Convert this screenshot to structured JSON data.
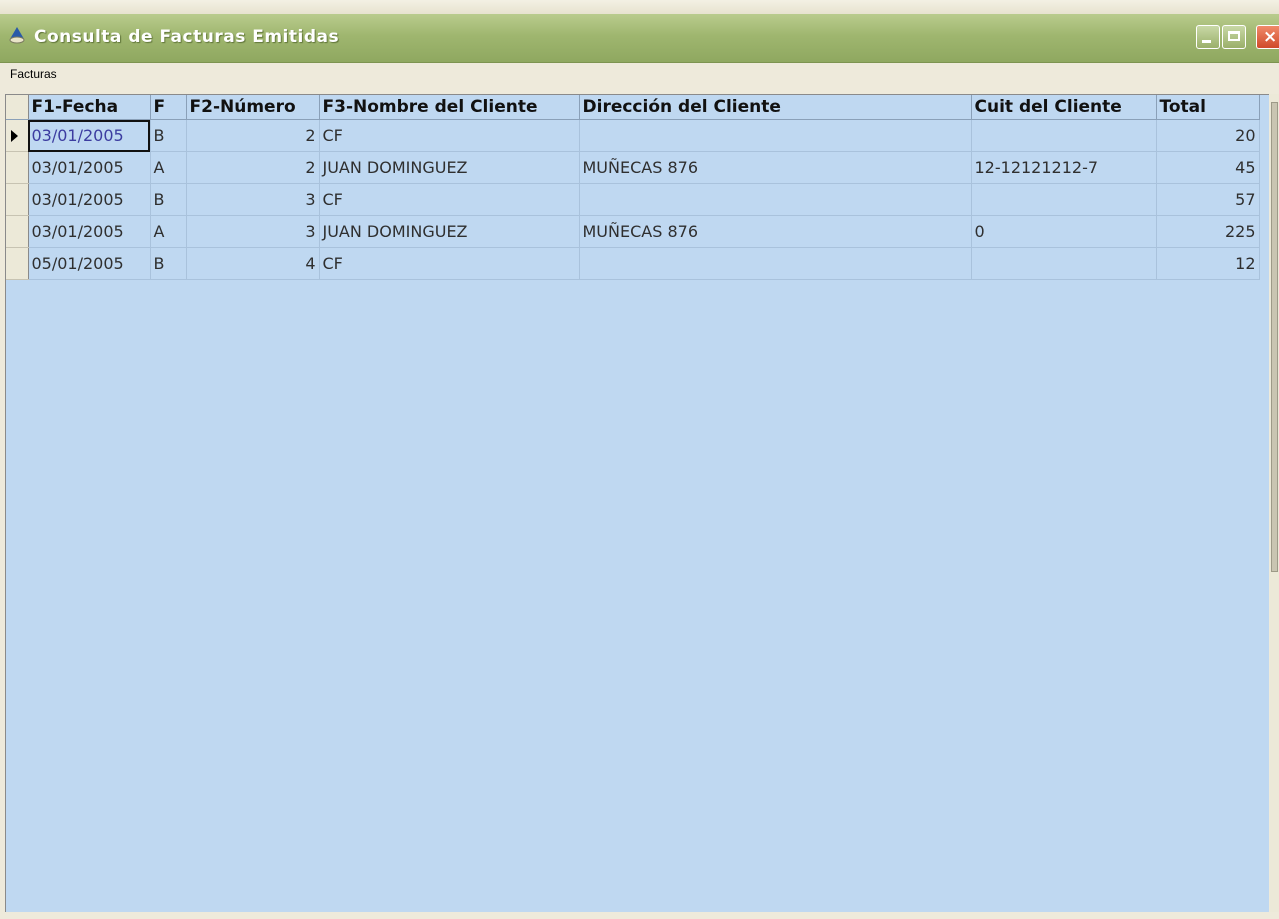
{
  "window": {
    "title": "Consulta de Facturas Emitidas",
    "icon": "app-icon",
    "controls": [
      "minimize-icon",
      "maximize-icon",
      "close-icon"
    ]
  },
  "menu": {
    "items": [
      {
        "label": "Facturas"
      }
    ]
  },
  "grid": {
    "columns": [
      "F1-Fecha",
      "F",
      "F2-Número",
      "F3-Nombre del Cliente",
      "Dirección del Cliente",
      "Cuit del Cliente",
      "Total"
    ],
    "rows": [
      {
        "fecha": "03/01/2005",
        "f": "B",
        "numero": "2",
        "nombre": "CF",
        "direccion": "",
        "cuit": "",
        "total": "20"
      },
      {
        "fecha": "03/01/2005",
        "f": "A",
        "numero": "2",
        "nombre": "JUAN DOMINGUEZ",
        "direccion": "MUÑECAS 876",
        "cuit": "12-12121212-7",
        "total": "45"
      },
      {
        "fecha": "03/01/2005",
        "f": "B",
        "numero": "3",
        "nombre": "CF",
        "direccion": "",
        "cuit": "",
        "total": "57"
      },
      {
        "fecha": "03/01/2005",
        "f": "A",
        "numero": "3",
        "nombre": "JUAN DOMINGUEZ",
        "direccion": "MUÑECAS 876",
        "cuit": "0",
        "total": "225"
      },
      {
        "fecha": "05/01/2005",
        "f": "B",
        "numero": "4",
        "nombre": "CF",
        "direccion": "",
        "cuit": "",
        "total": "12"
      }
    ],
    "current_row": 0
  },
  "colors": {
    "titlebar": "#9fb66f",
    "grid_background": "#bfd8f1",
    "window_background": "#eeeadb"
  }
}
